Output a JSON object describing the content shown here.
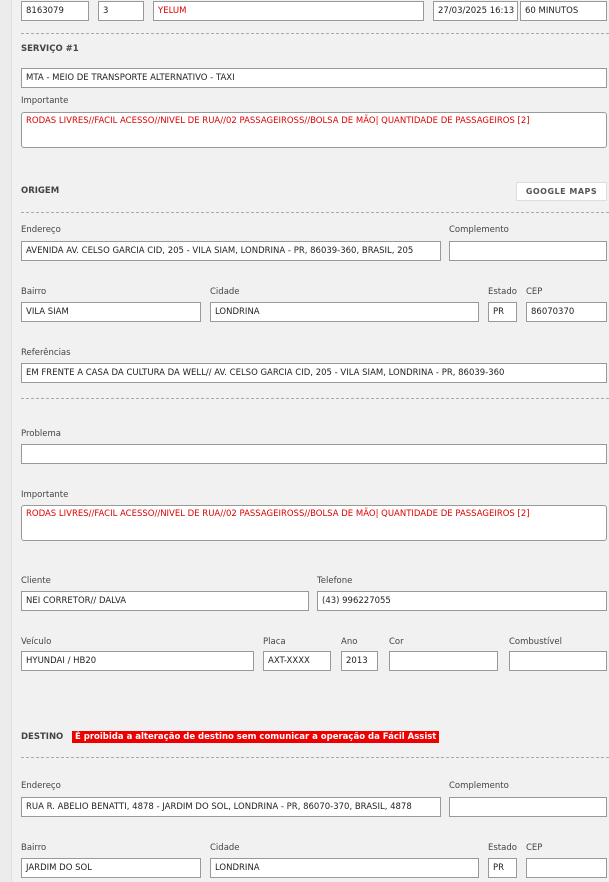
{
  "header": {
    "id": "8163079",
    "qty": "3",
    "name": "YELUM",
    "datetime": "27/03/2025 16:13",
    "time": "60 MINUTOS"
  },
  "service": {
    "title": "SERVIÇO #1",
    "type": "MTA - MEIO DE TRANSPORTE ALTERNATIVO - TAXI",
    "important_label": "Importante",
    "important": "RODAS LIVRES//FACIL ACESSO//NIVEL DE RUA//02 PASSAGEIROSS//BOLSA DE MÃO| QUANTIDADE DE PASSAGEIROS [2]"
  },
  "origin": {
    "title": "ORIGEM",
    "maps_button": "GOOGLE MAPS",
    "address_label": "Endereço",
    "address": "AVENIDA AV. CELSO GARCIA CID, 205 - VILA SIAM, LONDRINA - PR, 86039-360, BRASIL, 205",
    "complement_label": "Complemento",
    "complement": "",
    "district_label": "Bairro",
    "district": "VILA SIAM",
    "city_label": "Cidade",
    "city": "LONDRINA",
    "state_label": "Estado",
    "state": "PR",
    "zip_label": "CEP",
    "zip": "86070370",
    "ref_label": "Referências",
    "ref": "EM FRENTE A CASA DA CULTURA DA WELL// AV. CELSO GARCIA CID, 205 - VILA SIAM, LONDRINA - PR, 86039-360"
  },
  "details": {
    "problem_label": "Problema",
    "problem": "",
    "important_label": "Importante",
    "important": "RODAS LIVRES//FACIL ACESSO//NIVEL DE RUA//02 PASSAGEIROSS//BOLSA DE MÃO| QUANTIDADE DE PASSAGEIROS [2]",
    "client_label": "Cliente",
    "client": "NEI CORRETOR// DALVA",
    "phone_label": "Telefone",
    "phone": "(43) 996227055",
    "vehicle_label": "Veículo",
    "vehicle": "HYUNDAI / HB20",
    "plate_label": "Placa",
    "plate": "AXT-XXXX",
    "year_label": "Ano",
    "year": "2013",
    "color_label": "Cor",
    "color": "",
    "fuel_label": "Combustível",
    "fuel": ""
  },
  "destination": {
    "title": "DESTINO",
    "warning": "É proibida a alteração de destino sem comunicar a operação da Fácil Assist",
    "address_label": "Endereço",
    "address": "RUA R. ABELIO BENATTI, 4878 - JARDIM DO SOL, LONDRINA - PR, 86070-370, BRASIL, 4878",
    "complement_label": "Complemento",
    "complement": "",
    "district_label": "Bairro",
    "district": "JARDIM DO SOL",
    "city_label": "Cidade",
    "city": "LONDRINA",
    "state_label": "Estado",
    "state": "PR",
    "zip_label": "CEP",
    "zip": ""
  },
  "colors": {
    "warning_bg": "#ee0000",
    "important_text": "#dd0000"
  }
}
